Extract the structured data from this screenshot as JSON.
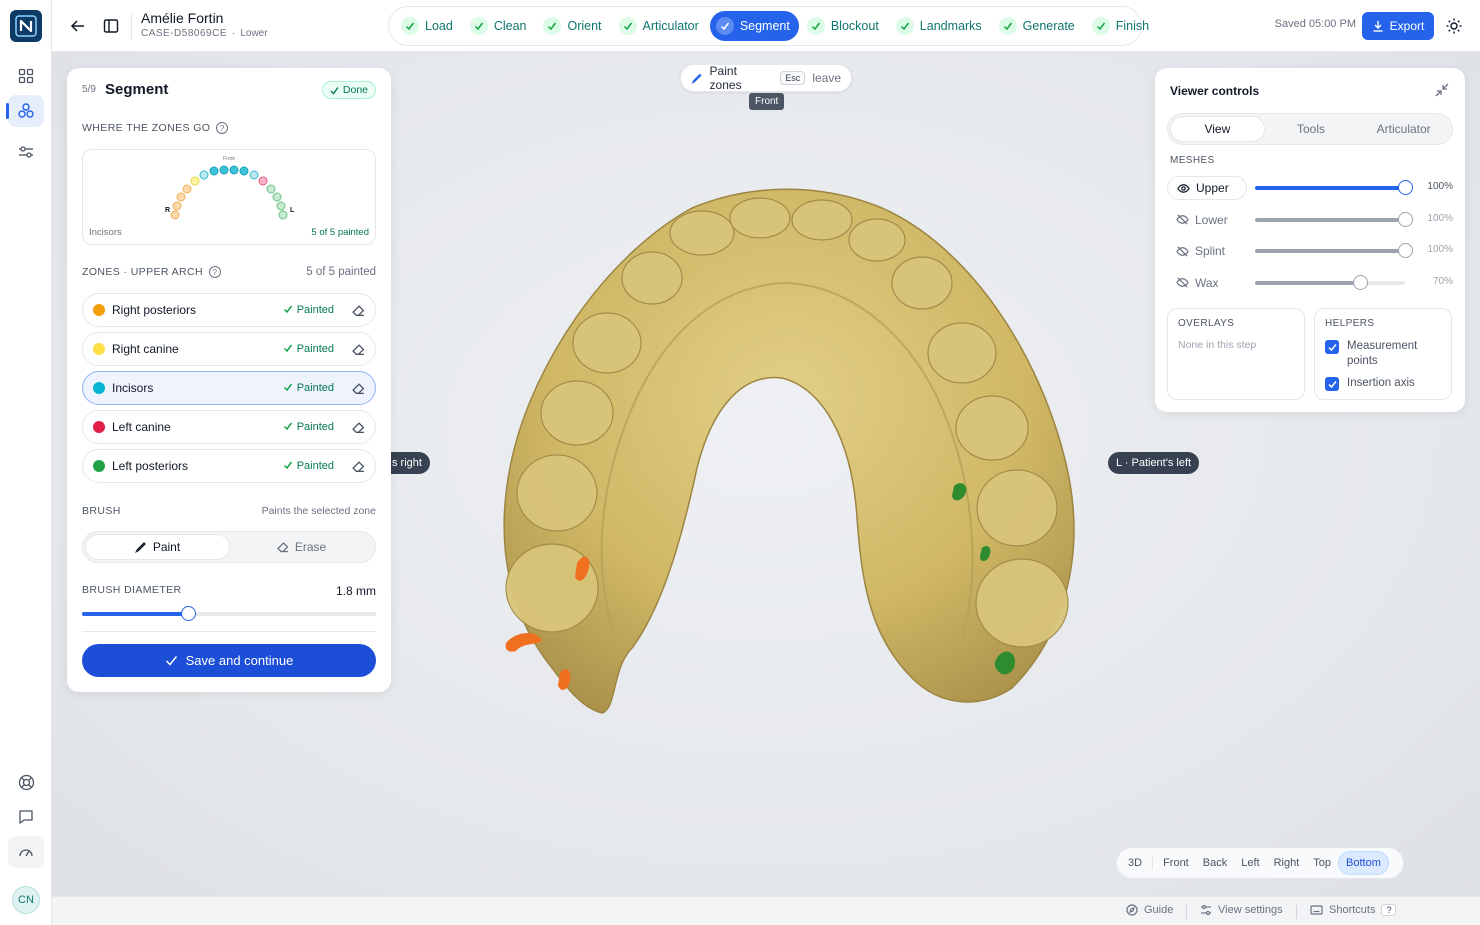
{
  "header": {
    "patient_name": "Amélie Fortin",
    "case_id": "CASE-D58069CE",
    "arch": "Lower",
    "saved": "Saved 05:00 PM",
    "export_label": "Export"
  },
  "steps": [
    {
      "label": "Load",
      "state": "done"
    },
    {
      "label": "Clean",
      "state": "done"
    },
    {
      "label": "Orient",
      "state": "done"
    },
    {
      "label": "Articulator",
      "state": "done"
    },
    {
      "label": "Segment",
      "state": "current"
    },
    {
      "label": "Blockout",
      "state": "done"
    },
    {
      "label": "Landmarks",
      "state": "done"
    },
    {
      "label": "Generate",
      "state": "done"
    },
    {
      "label": "Finish",
      "state": "done"
    }
  ],
  "viewport": {
    "paint_label": "Paint zones",
    "esc_key": "Esc",
    "leave_label": "leave",
    "front_tag": "Front",
    "right_tag": "s right",
    "left_tag": "L · Patient's left",
    "view_buttons": [
      "3D",
      "Front",
      "Back",
      "Left",
      "Right",
      "Top",
      "Bottom"
    ],
    "active_view": "Bottom"
  },
  "segment_panel": {
    "step_counter": "5/9",
    "title": "Segment",
    "status_badge": "Done",
    "map_section": "WHERE THE ZONES GO",
    "map_front": "Front",
    "map_r": "R",
    "map_l": "L",
    "map_caption_left": "Incisors",
    "map_caption_right": "5 of 5 painted",
    "zones_section": "ZONES · UPPER ARCH",
    "zones_count": "5 of 5 painted",
    "zones": [
      {
        "name": "Right posteriors",
        "status": "Painted",
        "color": "#f59e0b"
      },
      {
        "name": "Right canine",
        "status": "Painted",
        "color": "#fde047"
      },
      {
        "name": "Incisors",
        "status": "Painted",
        "color": "#06b6d4"
      },
      {
        "name": "Left canine",
        "status": "Painted",
        "color": "#e11d48"
      },
      {
        "name": "Left posteriors",
        "status": "Painted",
        "color": "#22a34a"
      }
    ],
    "selected_zone": "Incisors",
    "brush_section": "BRUSH",
    "brush_hint": "Paints the selected zone",
    "brush_modes": [
      "Paint",
      "Erase"
    ],
    "brush_mode_selected": "Paint",
    "diameter_section": "BRUSH DIAMETER",
    "diameter_value": "1.8 mm",
    "diameter_fraction": 0.36,
    "save_label": "Save and continue"
  },
  "viewer_controls": {
    "title": "Viewer controls",
    "tabs": [
      "View",
      "Tools",
      "Articulator"
    ],
    "active_tab": "View",
    "meshes_section": "MESHES",
    "meshes": [
      {
        "name": "Upper",
        "visible": true,
        "opacity": "100%",
        "value": 1.0
      },
      {
        "name": "Lower",
        "visible": false,
        "opacity": "100%",
        "value": 1.0
      },
      {
        "name": "Splint",
        "visible": false,
        "opacity": "100%",
        "value": 1.0
      },
      {
        "name": "Wax",
        "visible": false,
        "opacity": "70%",
        "value": 0.7
      }
    ],
    "overlays_section": "OVERLAYS",
    "overlays_empty": "None in this step",
    "helpers_section": "HELPERS",
    "helpers": [
      {
        "label": "Measurement points",
        "checked": true
      },
      {
        "label": "Insertion axis",
        "checked": true
      }
    ]
  },
  "footer": {
    "guide": "Guide",
    "view_settings": "View settings",
    "shortcuts": "Shortcuts",
    "shortcut_key": "?"
  },
  "rail": {
    "avatar_initials": "CN"
  }
}
